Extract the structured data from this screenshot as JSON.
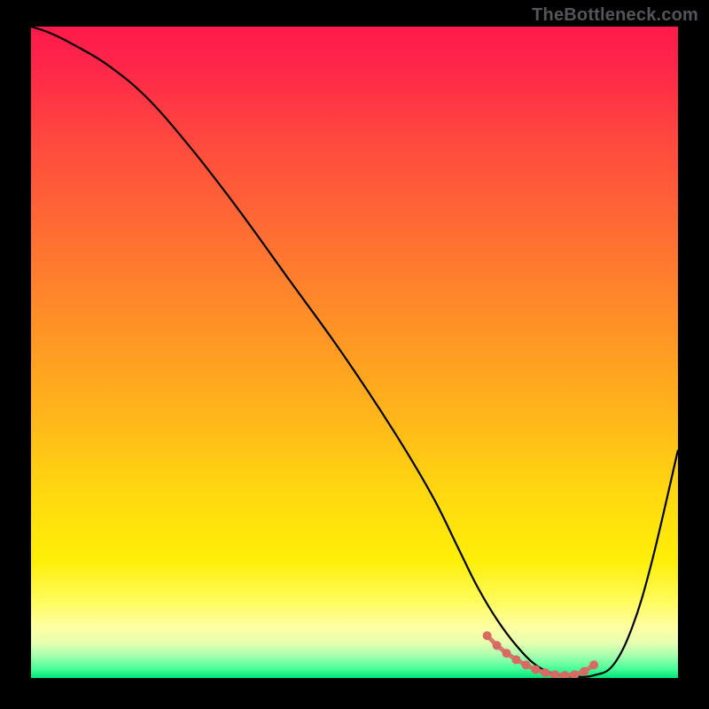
{
  "watermark": "TheBottleneck.com",
  "gradient_stops": [
    {
      "offset": 0.0,
      "color": "#ff1a4b"
    },
    {
      "offset": 0.06,
      "color": "#ff2649"
    },
    {
      "offset": 0.18,
      "color": "#ff4a3e"
    },
    {
      "offset": 0.32,
      "color": "#ff6e33"
    },
    {
      "offset": 0.46,
      "color": "#ff9226"
    },
    {
      "offset": 0.6,
      "color": "#ffb61a"
    },
    {
      "offset": 0.72,
      "color": "#ffd90f"
    },
    {
      "offset": 0.82,
      "color": "#ffef08"
    },
    {
      "offset": 0.88,
      "color": "#fffb5a"
    },
    {
      "offset": 0.92,
      "color": "#ffffa0"
    },
    {
      "offset": 0.945,
      "color": "#e8ffb0"
    },
    {
      "offset": 0.965,
      "color": "#aaffb0"
    },
    {
      "offset": 0.985,
      "color": "#4cff9a"
    },
    {
      "offset": 1.0,
      "color": "#00e57a"
    }
  ],
  "chart_data": {
    "type": "line",
    "title": "",
    "xlabel": "",
    "ylabel": "",
    "xlim": [
      0,
      100
    ],
    "ylim": [
      0,
      100
    ],
    "grid": false,
    "legend": false,
    "series": [
      {
        "name": "bottleneck-curve",
        "x": [
          0,
          3,
          7,
          12,
          18,
          25,
          32,
          40,
          48,
          56,
          62,
          66,
          69,
          72,
          75,
          78,
          81,
          84,
          87,
          90,
          93,
          96,
          100
        ],
        "y": [
          100,
          99,
          97,
          94,
          89,
          81,
          72,
          61,
          50,
          38,
          28,
          20,
          14,
          9,
          5,
          2,
          0.6,
          0.2,
          0.4,
          2,
          8,
          18,
          35
        ]
      },
      {
        "name": "highlight-band",
        "kind": "points",
        "color": "#d86a63",
        "x": [
          70.5,
          72,
          73.5,
          75,
          76.5,
          78,
          79.5,
          81,
          82.5,
          84,
          85.5,
          87
        ],
        "y": [
          6.5,
          5,
          3.8,
          2.8,
          2.0,
          1.3,
          0.8,
          0.5,
          0.4,
          0.5,
          1.0,
          2.0
        ]
      }
    ],
    "annotations": []
  }
}
